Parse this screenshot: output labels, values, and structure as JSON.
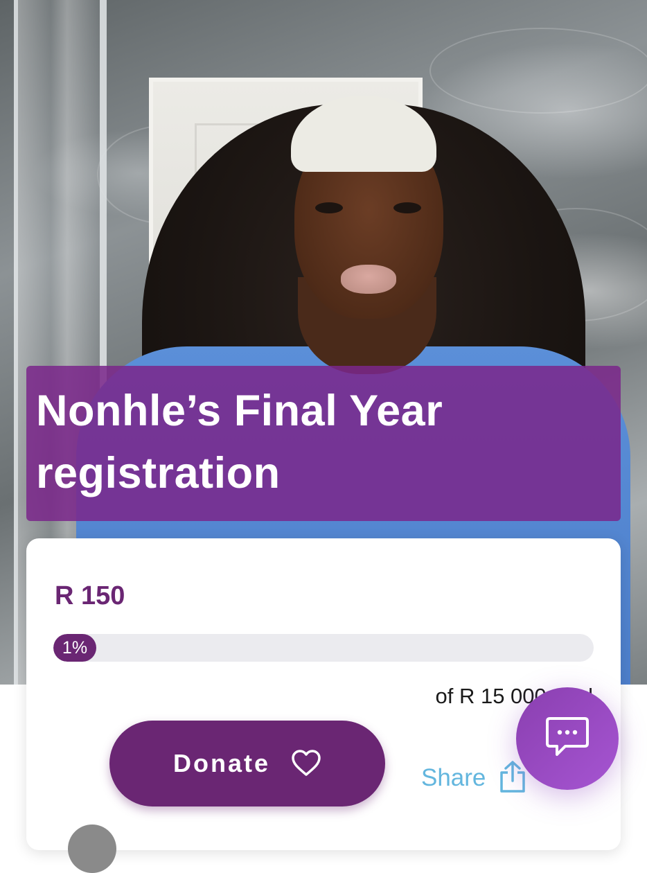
{
  "campaign": {
    "title": "Nonhle’s Final Year registration",
    "title_line1": "Nonhle’s Final Year",
    "title_line2": "registration",
    "raised": "R 150",
    "progress_label": "1%",
    "progress_fraction": 0.01,
    "goal": "of R 15 000 goal"
  },
  "actions": {
    "donate_label": "Donate",
    "donate_icon": "heart-outline-icon",
    "share_label": "Share",
    "share_icon": "share-upload-icon",
    "chat_icon": "chat-bubble-icon"
  },
  "colors": {
    "brand_purple": "#6a2673",
    "banner_purple": "#7a268a",
    "share_blue": "#63b6de",
    "chat_gradient_start": "#8a3fb0",
    "chat_gradient_end": "#a655d2"
  }
}
